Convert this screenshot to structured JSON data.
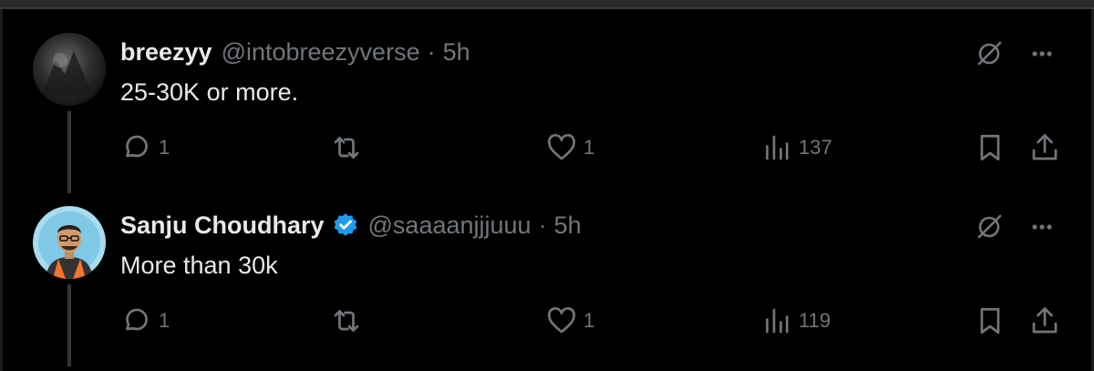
{
  "tweets": [
    {
      "name": "breezyy",
      "verified": false,
      "handle": "@intobreezyverse",
      "separator": "·",
      "time": "5h",
      "text": "25-30K or more.",
      "replies": "1",
      "reposts": "",
      "likes": "1",
      "views": "137",
      "avatar_icon": "dark-photo-avatar"
    },
    {
      "name": "Sanju Choudhary",
      "verified": true,
      "handle": "@saaaanjjjuuu",
      "separator": "·",
      "time": "5h",
      "text": "More than 30k",
      "replies": "1",
      "reposts": "",
      "likes": "1",
      "views": "119",
      "avatar_icon": "illustrated-person-avatar"
    }
  ],
  "colors": {
    "background": "#000000",
    "text_primary": "#e7e9ea",
    "text_secondary": "#71767b",
    "verified_blue": "#1d9bf0",
    "thread_line": "#333639"
  },
  "icons": [
    "grok-icon",
    "more-icon",
    "reply-icon",
    "repost-icon",
    "like-icon",
    "views-icon",
    "bookmark-icon",
    "share-icon"
  ]
}
